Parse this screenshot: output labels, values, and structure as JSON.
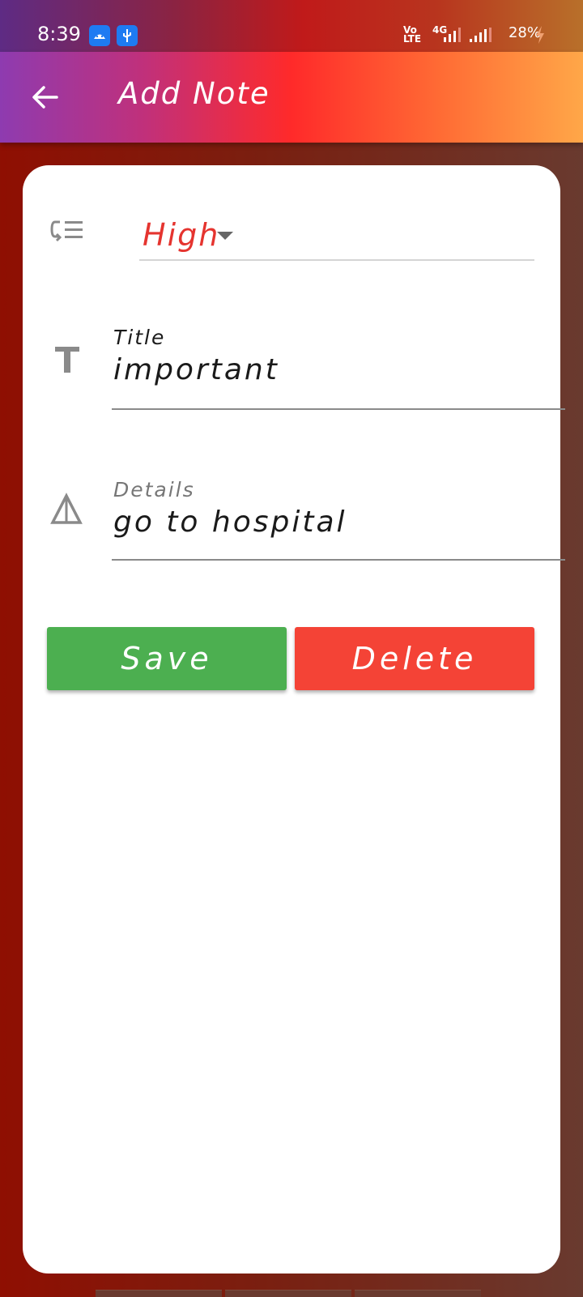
{
  "status_bar": {
    "time": "8:39",
    "notif_icons": [
      "android-icon",
      "usb-icon"
    ],
    "network_label_top": "Vo",
    "network_label_bottom": "LTE",
    "network_type": "4G",
    "battery": "28%"
  },
  "toolbar": {
    "title": "Add Note",
    "back_icon": "arrow-left-icon"
  },
  "form": {
    "priority": {
      "value": "High",
      "icon": "priority-list-icon",
      "color": "#e5342f"
    },
    "title_field": {
      "label": "Title",
      "value": "important",
      "icon": "text-t-icon"
    },
    "details_field": {
      "label": "Details",
      "value": "go to hospital",
      "icon": "triangle-icon"
    }
  },
  "buttons": {
    "save_label": "Save",
    "delete_label": "Delete",
    "save_color": "#4caf50",
    "delete_color": "#f44336"
  }
}
